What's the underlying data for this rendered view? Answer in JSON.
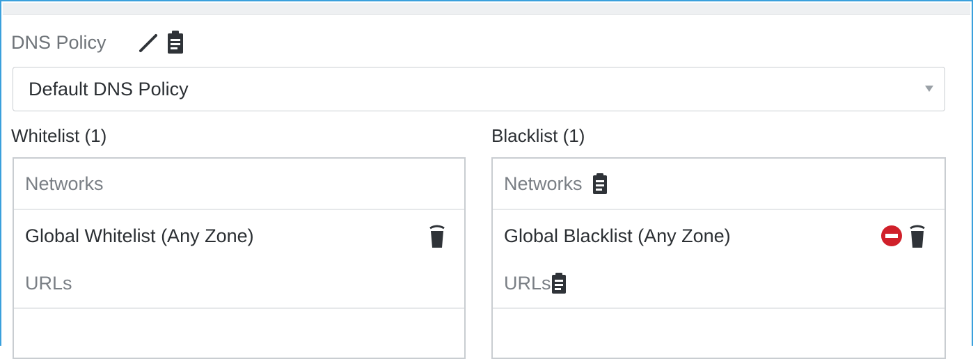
{
  "dns_policy": {
    "label": "DNS Policy",
    "selected": "Default DNS Policy",
    "icons": [
      "pencil-icon",
      "clipboard-icon"
    ]
  },
  "whitelist": {
    "title": "Whitelist (1)",
    "networks_label": "Networks",
    "entries": [
      {
        "label": "Global Whitelist (Any Zone)",
        "icons": [
          "trash-icon"
        ]
      }
    ],
    "urls_label": "URLs"
  },
  "blacklist": {
    "title": "Blacklist (1)",
    "networks_label": "Networks",
    "entries": [
      {
        "label": "Global Blacklist (Any Zone)",
        "icons": [
          "remove-icon",
          "trash-icon"
        ]
      }
    ],
    "urls_label": "URLs"
  },
  "colors": {
    "accent_border": "#3aa0dc",
    "remove_red": "#d0202a",
    "icon_dark": "#3a3f44"
  }
}
